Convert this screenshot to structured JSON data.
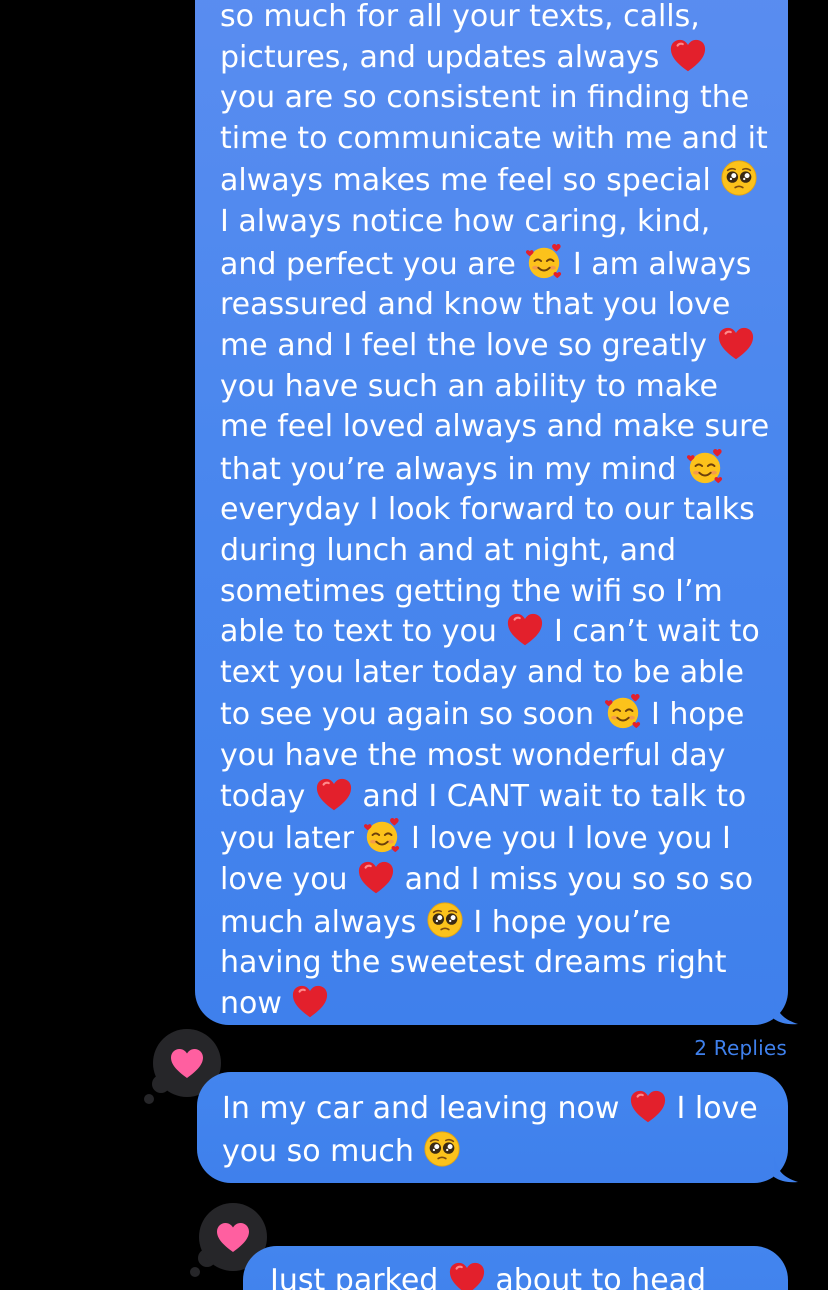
{
  "messages": [
    {
      "segments": [
        {
          "t": "text",
          "v": "so much for all your texts, calls, pictures, and updates always "
        },
        {
          "t": "emoji",
          "v": "red-heart"
        },
        {
          "t": "text",
          "v": " you are so consistent in finding the time to communicate with me and it always makes me feel so special "
        },
        {
          "t": "emoji",
          "v": "pleading-face"
        },
        {
          "t": "text",
          "v": " I always notice how caring, kind, and perfect you are "
        },
        {
          "t": "emoji",
          "v": "smiling-face-with-hearts"
        },
        {
          "t": "text",
          "v": " I am always reassured and know that you love me and I feel the love so greatly "
        },
        {
          "t": "emoji",
          "v": "red-heart"
        },
        {
          "t": "text",
          "v": " you have such an ability to make me feel loved always and make sure that you’re always in my mind "
        },
        {
          "t": "emoji",
          "v": "smiling-face-with-hearts"
        },
        {
          "t": "text",
          "v": " everyday I look forward to our talks during lunch and at night, and sometimes getting the wifi so I’m able to text to you "
        },
        {
          "t": "emoji",
          "v": "red-heart"
        },
        {
          "t": "text",
          "v": " I can’t wait to text you later today and to be able to see you again so soon "
        },
        {
          "t": "emoji",
          "v": "smiling-face-with-hearts"
        },
        {
          "t": "text",
          "v": " I hope you have the most wonderful day today "
        },
        {
          "t": "emoji",
          "v": "red-heart"
        },
        {
          "t": "text",
          "v": " and I CANT wait to talk to you later "
        },
        {
          "t": "emoji",
          "v": "smiling-face-with-hearts"
        },
        {
          "t": "text",
          "v": " I love you I love you I love you "
        },
        {
          "t": "emoji",
          "v": "red-heart"
        },
        {
          "t": "text",
          "v": " and I miss you so so so much always "
        },
        {
          "t": "emoji",
          "v": "pleading-face"
        },
        {
          "t": "text",
          "v": " I hope you’re having the sweetest dreams right now "
        },
        {
          "t": "emoji",
          "v": "red-heart"
        }
      ],
      "replies_label": "2 Replies"
    },
    {
      "segments": [
        {
          "t": "text",
          "v": "In my car and leaving now "
        },
        {
          "t": "emoji",
          "v": "red-heart"
        },
        {
          "t": "text",
          "v": " I love you so much "
        },
        {
          "t": "emoji",
          "v": "pleading-face"
        }
      ],
      "tapback": "heart-icon"
    },
    {
      "segments": [
        {
          "t": "text",
          "v": "Just parked "
        },
        {
          "t": "emoji",
          "v": "red-heart"
        },
        {
          "t": "text",
          "v": " about to head"
        }
      ],
      "tapback": "heart-icon"
    }
  ],
  "colors": {
    "bubble": "#3f80ec",
    "background": "#000000",
    "tapback_bg": "#262629",
    "tapback_heart": "#ff5fa0",
    "replies_text": "#3f80ec"
  }
}
